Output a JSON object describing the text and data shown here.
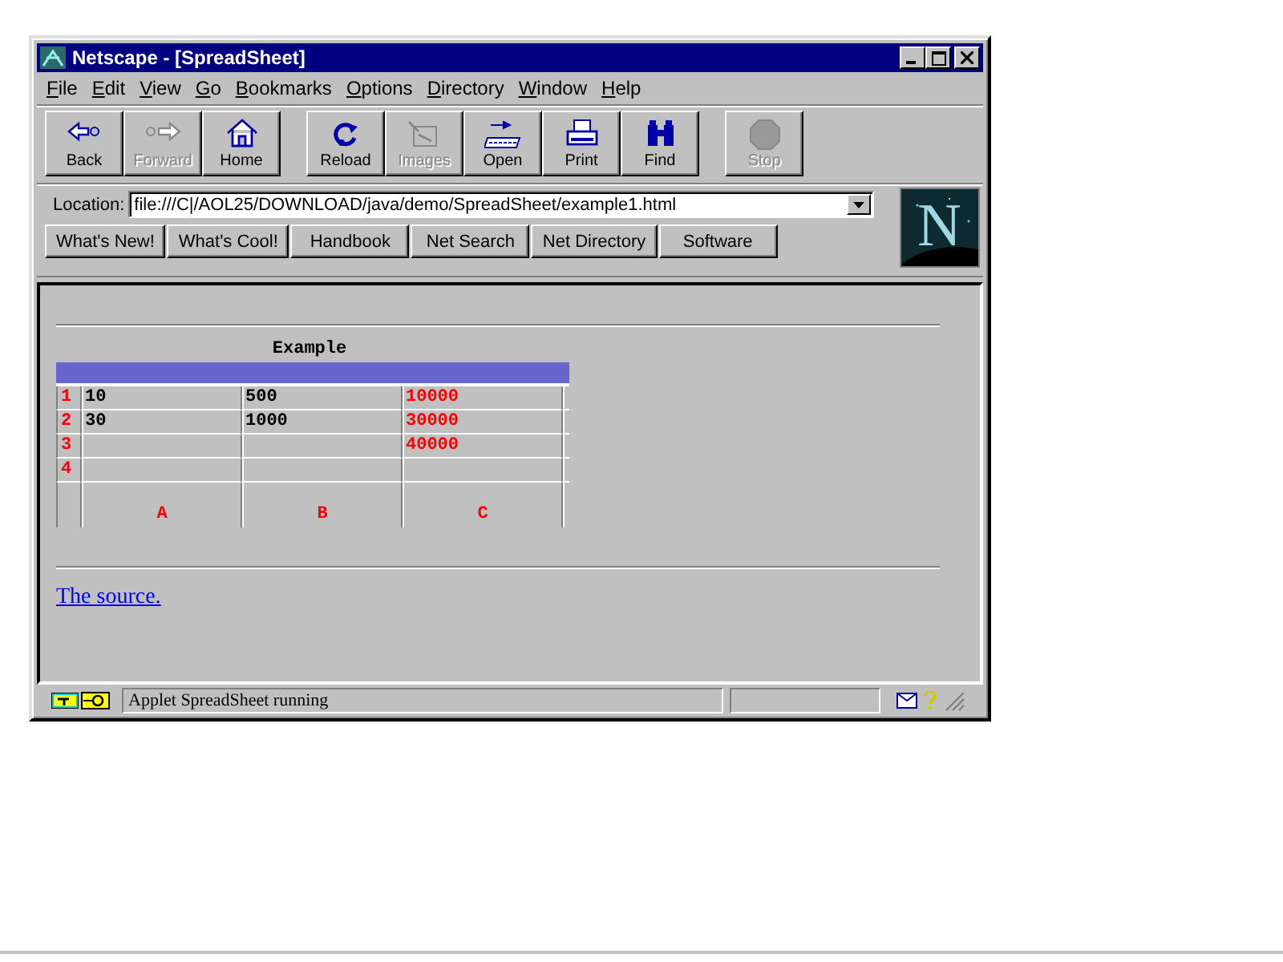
{
  "window": {
    "title": "Netscape - [SpreadSheet]"
  },
  "menu": [
    "File",
    "Edit",
    "View",
    "Go",
    "Bookmarks",
    "Options",
    "Directory",
    "Window",
    "Help"
  ],
  "toolbar_groups": [
    [
      {
        "label": "Back",
        "kind": "back",
        "disabled": false
      },
      {
        "label": "Forward",
        "kind": "forward",
        "disabled": true
      },
      {
        "label": "Home",
        "kind": "home",
        "disabled": false
      }
    ],
    [
      {
        "label": "Reload",
        "kind": "reload",
        "disabled": false
      },
      {
        "label": "Images",
        "kind": "images",
        "disabled": true
      },
      {
        "label": "Open",
        "kind": "open",
        "disabled": false
      },
      {
        "label": "Print",
        "kind": "print",
        "disabled": false
      },
      {
        "label": "Find",
        "kind": "find",
        "disabled": false
      }
    ],
    [
      {
        "label": "Stop",
        "kind": "stop",
        "disabled": true
      }
    ]
  ],
  "location": {
    "label": "Location:",
    "value": "file:///C|/AOL25/DOWNLOAD/java/demo/SpreadSheet/example1.html"
  },
  "directory_buttons": [
    "What's New!",
    "What's Cool!",
    "Handbook",
    "Net Search",
    "Net Directory",
    "Software"
  ],
  "logo": "N",
  "page": {
    "heading": "Example",
    "rows": [
      {
        "number": "1",
        "cells": [
          {
            "value": "10",
            "computed": false
          },
          {
            "value": "500",
            "computed": false
          },
          {
            "value": "10000",
            "computed": true
          }
        ]
      },
      {
        "number": "2",
        "cells": [
          {
            "value": "30",
            "computed": false
          },
          {
            "value": "1000",
            "computed": false
          },
          {
            "value": "30000",
            "computed": true
          }
        ]
      },
      {
        "number": "3",
        "cells": [
          null,
          null,
          {
            "value": "40000",
            "computed": true
          }
        ]
      },
      {
        "number": "4",
        "cells": [
          null,
          null,
          null
        ]
      }
    ],
    "column_footer": [
      "A",
      "B",
      "C"
    ],
    "link": "The source."
  },
  "status_bar": {
    "text": "Applet SpreadSheet running"
  }
}
